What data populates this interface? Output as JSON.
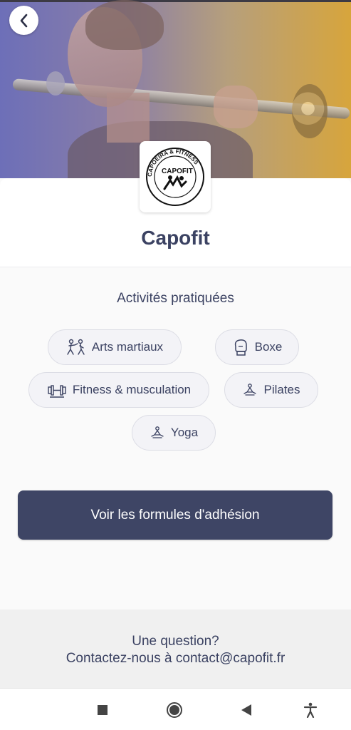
{
  "club": {
    "name": "Capofit",
    "logo_text": "CAPOFIT",
    "logo_ring_text": "CAPOEIRA & FITNESS"
  },
  "activities": {
    "title": "Activités pratiquées",
    "items": [
      {
        "label": "Arts martiaux",
        "icon": "martial-arts-icon"
      },
      {
        "label": "Boxe",
        "icon": "boxing-glove-icon"
      },
      {
        "label": "Fitness & musculation",
        "icon": "dumbbell-icon"
      },
      {
        "label": "Pilates",
        "icon": "meditation-icon"
      },
      {
        "label": "Yoga",
        "icon": "meditation-icon"
      }
    ]
  },
  "cta": {
    "label": "Voir les formules d'adhésion"
  },
  "footer": {
    "question": "Une question?",
    "contact": "Contactez-nous à contact@capofit.fr"
  },
  "navbar": {
    "icons": [
      "stop-square-icon",
      "home-circle-icon",
      "back-triangle-icon",
      "accessibility-icon"
    ]
  },
  "colors": {
    "primary": "#3e4565",
    "text": "#3b4262",
    "chip_bg": "#f3f3f7",
    "footer_bg": "#f0f0f0"
  }
}
